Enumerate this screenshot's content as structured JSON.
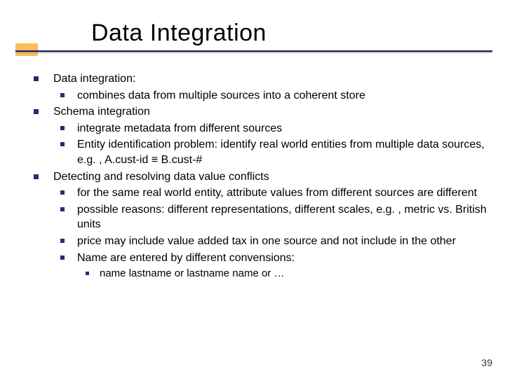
{
  "title": "Data Integration",
  "items": [
    {
      "level": 1,
      "text": "Data integration:"
    },
    {
      "level": 2,
      "text": "combines data from multiple sources into a coherent store"
    },
    {
      "level": 1,
      "text": "Schema integration"
    },
    {
      "level": 2,
      "text": "integrate metadata from different sources"
    },
    {
      "level": 2,
      "text": "Entity identification problem: identify real world entities from multiple data sources, e.g. , A.cust-id ≡ B.cust-#"
    },
    {
      "level": 1,
      "text": "Detecting and resolving data value conflicts"
    },
    {
      "level": 2,
      "text": "for the same real world entity, attribute values from different sources are different"
    },
    {
      "level": 2,
      "text": "possible reasons: different representations, different scales, e.g. , metric vs. British units"
    },
    {
      "level": 2,
      "text": "price may include value added tax in one source and  not include in the other"
    },
    {
      "level": 2,
      "text": "Name are entered by different convensions:"
    },
    {
      "level": 3,
      "text": "name lastname or lastname name or …"
    }
  ],
  "pageNumber": "39"
}
